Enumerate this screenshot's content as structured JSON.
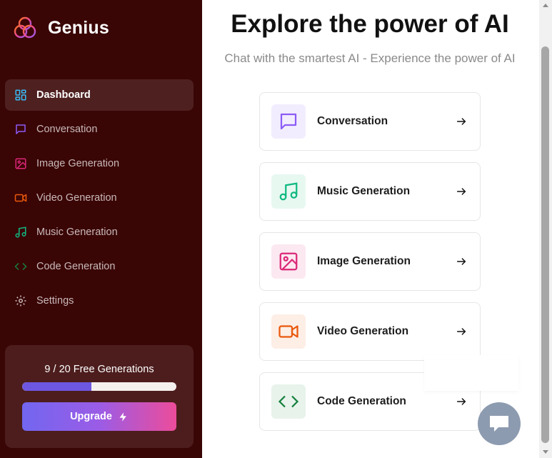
{
  "brand": {
    "name": "Genius"
  },
  "sidebar": {
    "items": [
      {
        "label": "Dashboard",
        "icon": "dashboard-icon",
        "color": "#38bdf8"
      },
      {
        "label": "Conversation",
        "icon": "message-icon",
        "color": "#8b5cf6"
      },
      {
        "label": "Image Generation",
        "icon": "image-icon",
        "color": "#db2777"
      },
      {
        "label": "Video Generation",
        "icon": "video-icon",
        "color": "#ea580c"
      },
      {
        "label": "Music Generation",
        "icon": "music-icon",
        "color": "#10b981"
      },
      {
        "label": "Code Generation",
        "icon": "code-icon",
        "color": "#15803d"
      },
      {
        "label": "Settings",
        "icon": "gear-icon",
        "color": "#c9b9b9"
      }
    ]
  },
  "usage": {
    "text": "9 / 20 Free Generations",
    "fraction": 0.45,
    "upgrade_label": "Upgrade"
  },
  "main": {
    "title": "Explore the power of AI",
    "subtitle": "Chat with the smartest AI - Experience the power of AI",
    "tools": [
      {
        "label": "Conversation",
        "icon": "message-icon",
        "color": "#8b5cf6",
        "bg": "#f2edfe"
      },
      {
        "label": "Music Generation",
        "icon": "music-icon",
        "color": "#10b981",
        "bg": "#e7f8f1"
      },
      {
        "label": "Image Generation",
        "icon": "image-icon",
        "color": "#db2777",
        "bg": "#fce8f1"
      },
      {
        "label": "Video Generation",
        "icon": "video-icon",
        "color": "#ea580c",
        "bg": "#fdeee6"
      },
      {
        "label": "Code Generation",
        "icon": "code-icon",
        "color": "#15803d",
        "bg": "#e8f3ec"
      }
    ]
  }
}
